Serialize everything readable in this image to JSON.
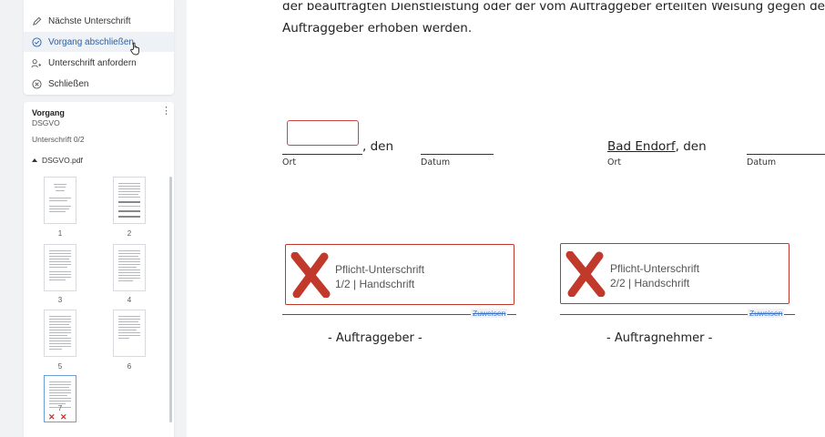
{
  "menu": {
    "items": [
      {
        "label": "Nächste Unterschrift",
        "icon": "pen-icon"
      },
      {
        "label": "Vorgang abschließen",
        "icon": "check-circle-icon"
      },
      {
        "label": "Unterschrift anfordern",
        "icon": "person-add-icon"
      },
      {
        "label": "Schließen",
        "icon": "close-circle-icon"
      }
    ],
    "active_index": 1
  },
  "vorgang": {
    "title": "Vorgang",
    "subtitle": "DSGVO",
    "signatures": "Unterschrift 0/2",
    "file": "DSGVO.pdf",
    "pages": [
      "1",
      "2",
      "3",
      "4",
      "5",
      "6",
      "7"
    ],
    "selected_page": "7"
  },
  "document": {
    "line1": "der beauftragten Dienstleistung oder der vom Auftraggeber erteilten Weisung gegen den",
    "line2": "Auftraggeber erhoben werden.",
    "left": {
      "den": ", den",
      "ort_label": "Ort",
      "datum_label": "Datum"
    },
    "right": {
      "place": "Bad Endorf",
      "den": ", den",
      "ort_label": "Ort",
      "datum_label": "Datum"
    },
    "signatures": [
      {
        "title": "Pflicht-Unterschrift",
        "detail": "1/2 | Handschrift",
        "assign": "Zuweisen",
        "role": "- Auftraggeber -"
      },
      {
        "title": "Pflicht-Unterschrift",
        "detail": "2/2 | Handschrift",
        "assign": "Zuweisen",
        "role": "- Auftragnehmer -"
      }
    ]
  },
  "colors": {
    "accent": "#2f5f9e",
    "required": "#c0392b",
    "sidebar_bg": "#f1f2f4"
  }
}
